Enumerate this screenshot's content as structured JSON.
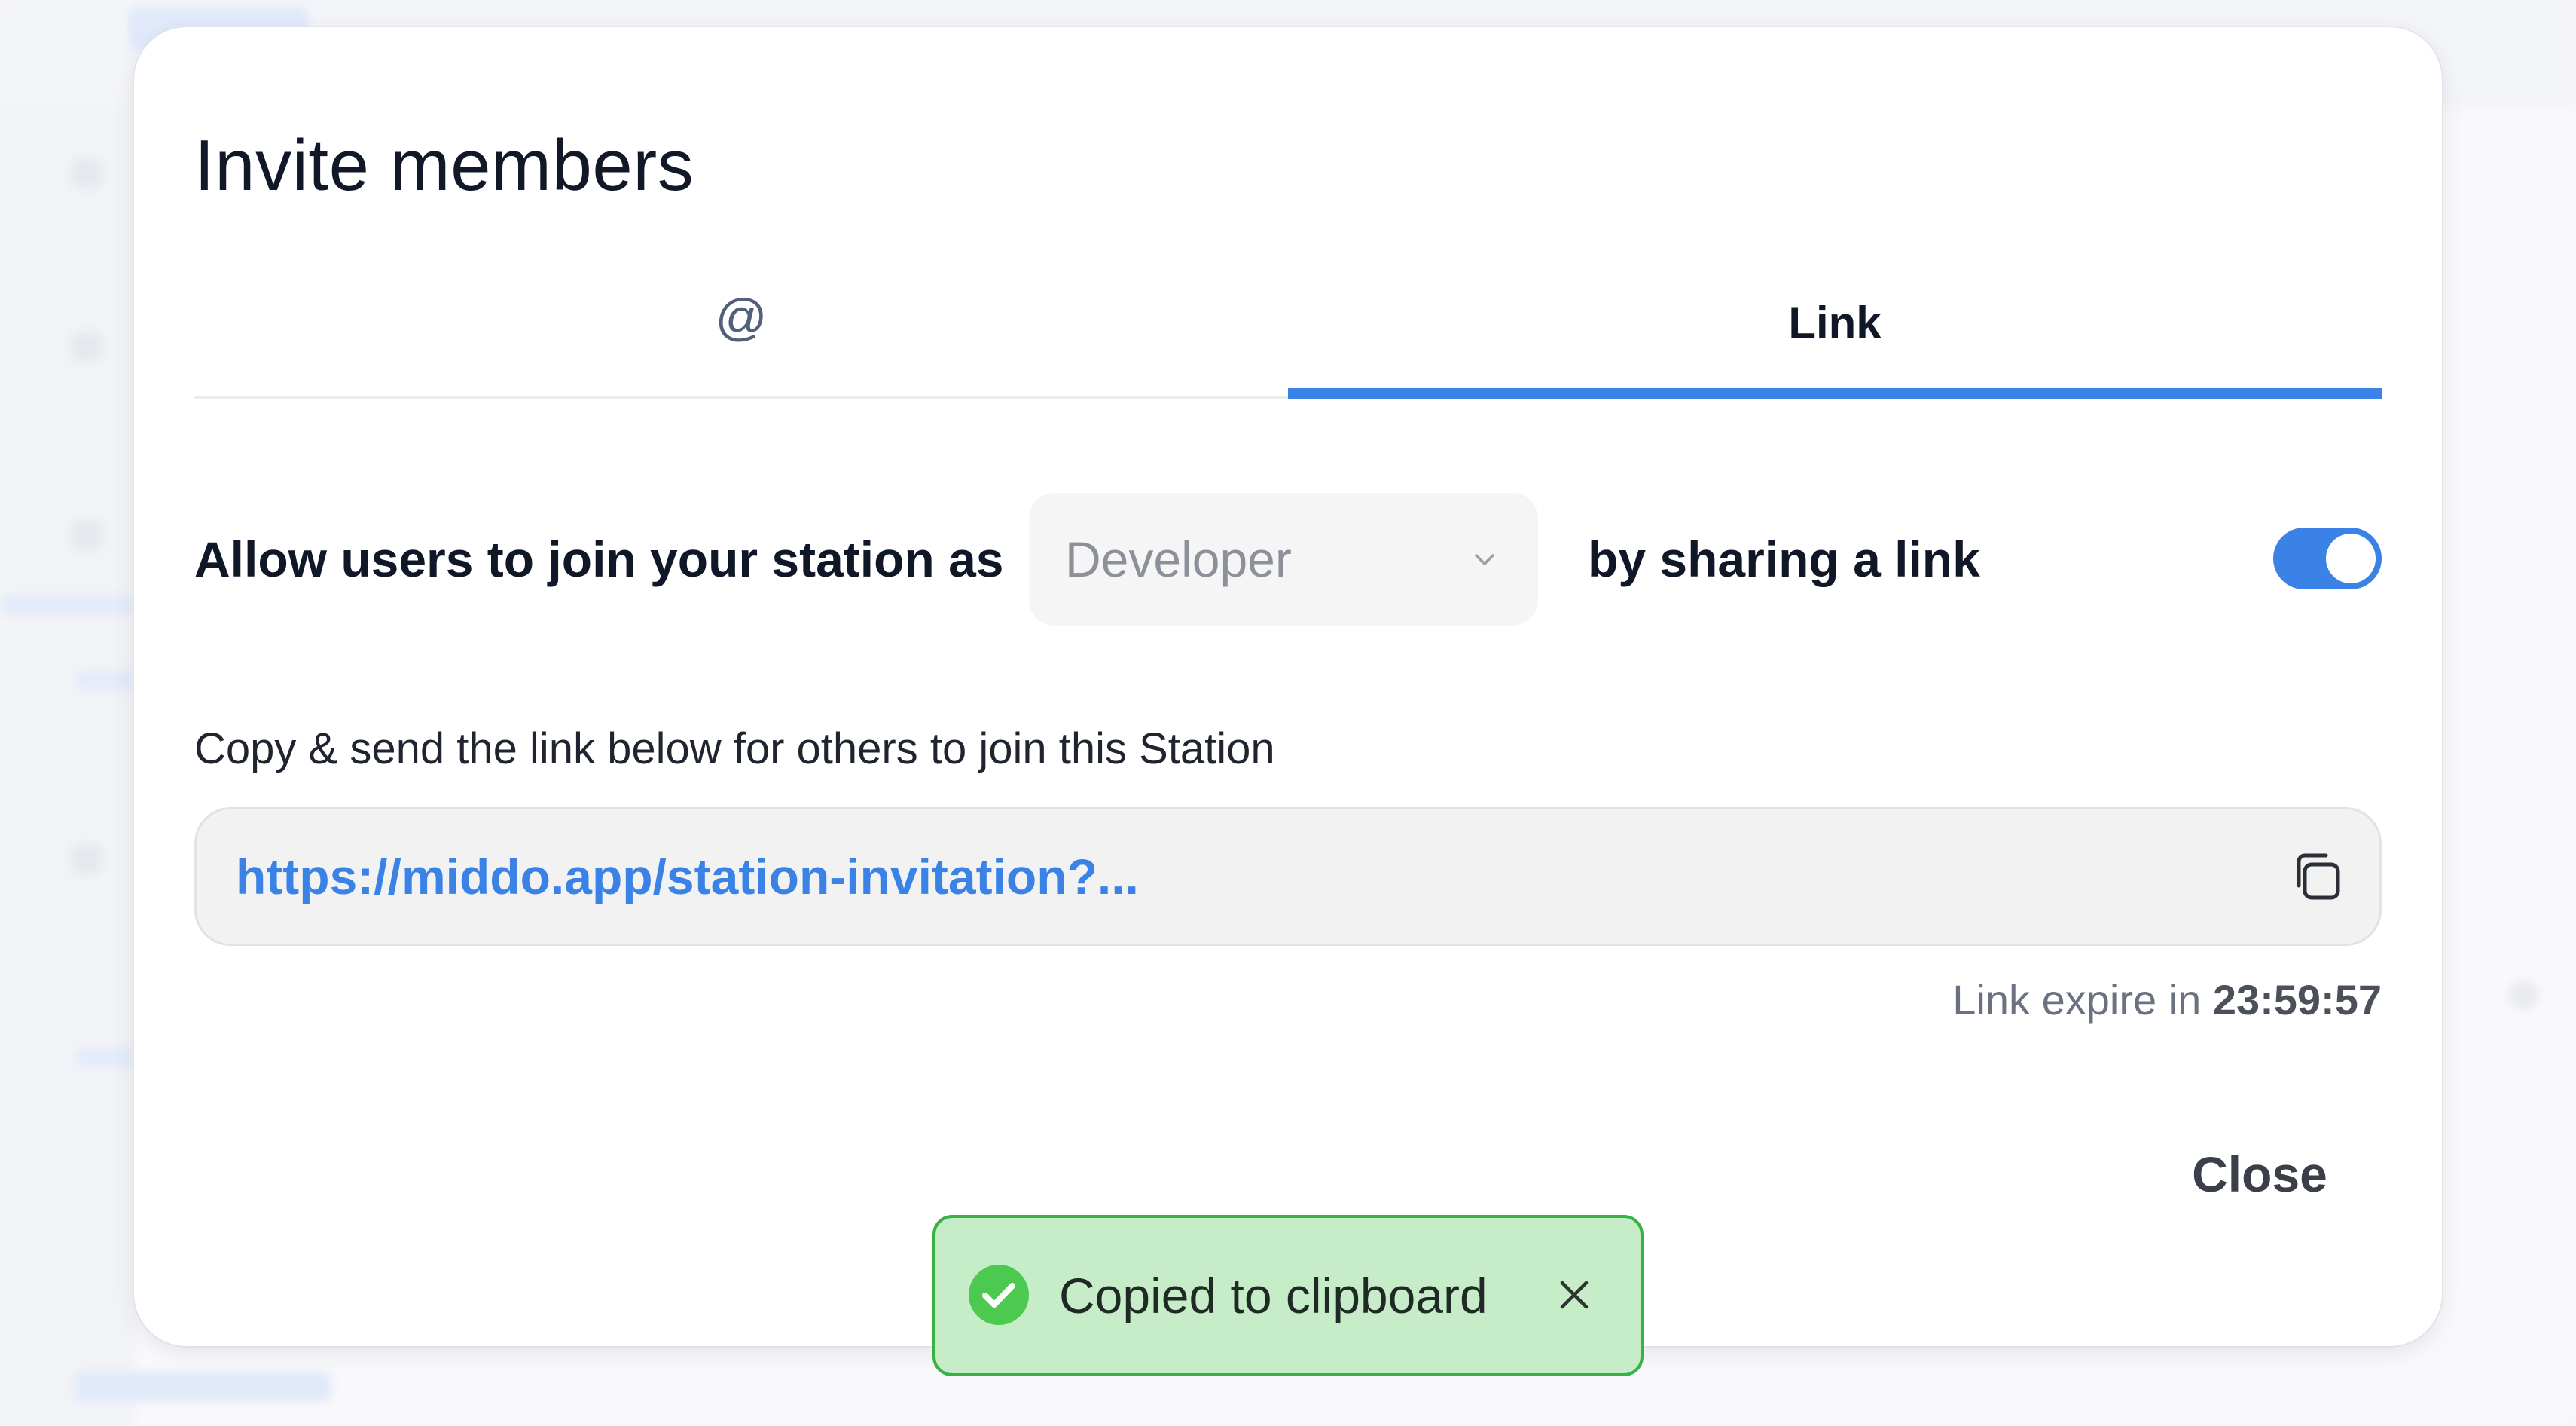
{
  "dialog": {
    "title": "Invite members",
    "tabs": [
      {
        "label": "@",
        "icon": "at-icon",
        "active": false
      },
      {
        "label": "Link",
        "active": true
      }
    ],
    "permission": {
      "prefix": "Allow users to join your station as",
      "role": "Developer",
      "suffix": "by sharing a link",
      "enabled": true
    },
    "instructions": "Copy & send the link below for others to join this Station",
    "link": {
      "url": "https://middo.app/station-invitation?...",
      "copy_icon": "copy-icon"
    },
    "expire": {
      "label": "Link expire in",
      "time": "23:59:57"
    },
    "close_label": "Close"
  },
  "toast": {
    "message": "Copied to clipboard",
    "icon": "check-circle-icon",
    "close_icon": "close-icon"
  },
  "colors": {
    "accent": "#3b82e6",
    "toast_bg": "#c6ecc8",
    "toast_border": "#38b244",
    "toast_check": "#4cc94f"
  }
}
